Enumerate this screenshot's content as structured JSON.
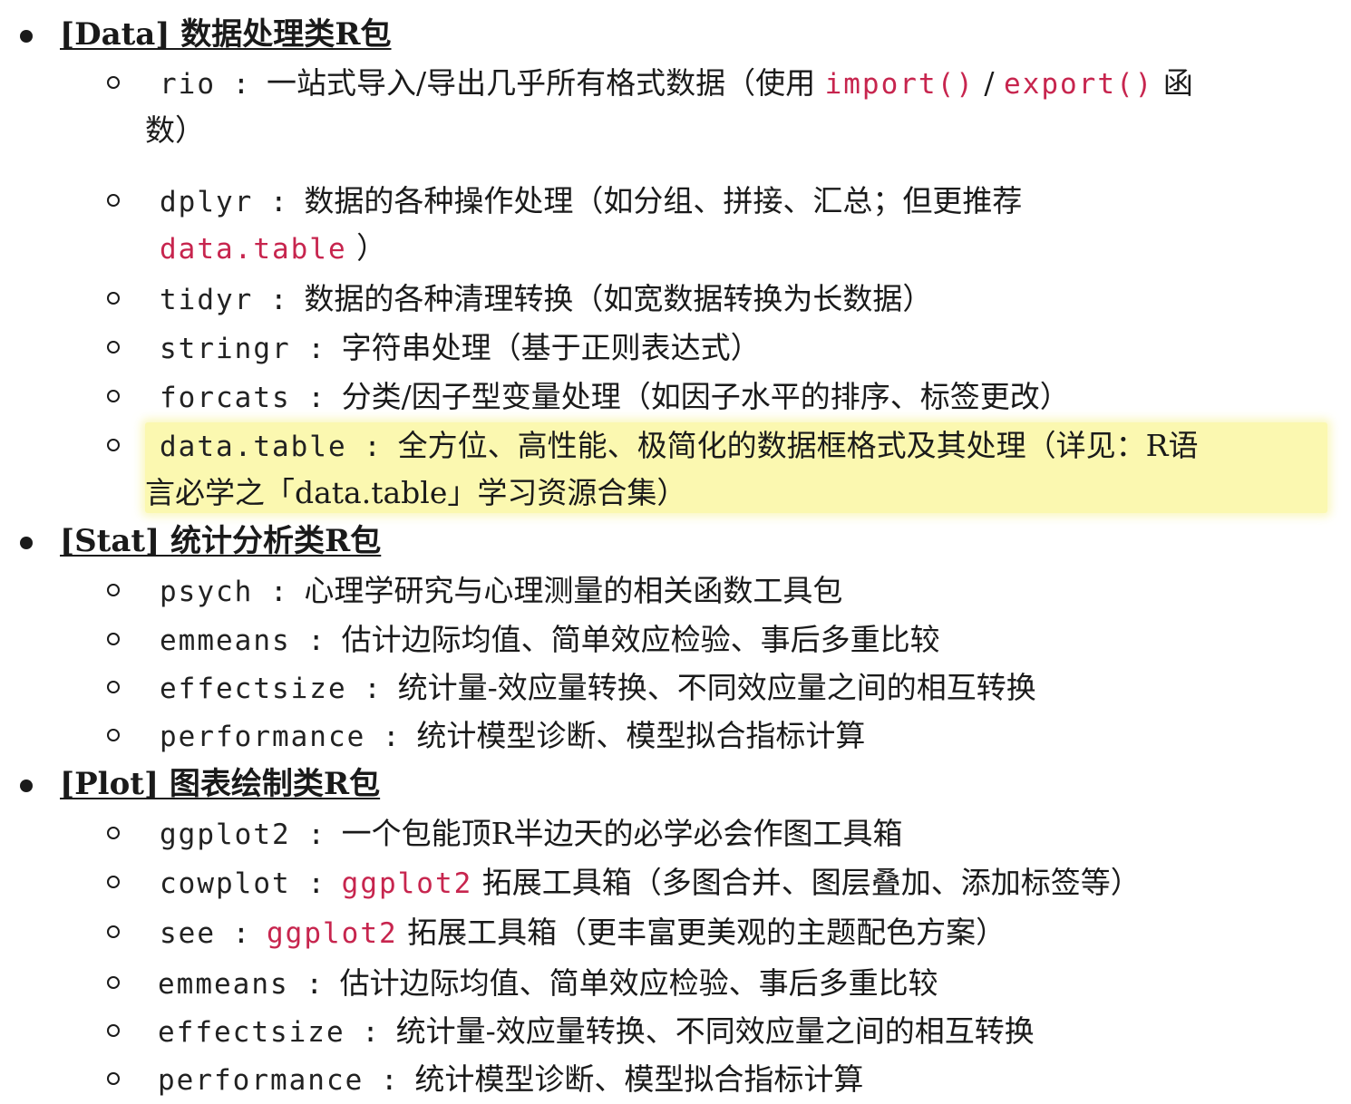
{
  "sections": [
    {
      "title": "[Data] 数据处理类R包",
      "items": [
        {
          "pkg": "rio",
          "sep": " : ",
          "desc_a": "一站式导入/导出几乎所有格式数据（使用 ",
          "code1": "import()",
          "mid": " / ",
          "code2": "export()",
          "desc_b": " 函",
          "desc_c": "数）"
        },
        {
          "pkg": "dplyr",
          "sep": " : ",
          "desc_a": "数据的各种操作处理（如分组、拼接、汇总；但更推荐",
          "code1": "data.table",
          "desc_b": " ）"
        },
        {
          "pkg": "tidyr",
          "sep": " : ",
          "desc": "数据的各种清理转换（如宽数据转换为长数据）"
        },
        {
          "pkg": "stringr",
          "sep": " : ",
          "desc": "字符串处理（基于正则表达式）"
        },
        {
          "pkg": "forcats",
          "sep": " : ",
          "desc": "分类/因子型变量处理（如因子水平的排序、标签更改）"
        },
        {
          "pkg": "data.table",
          "sep": " : ",
          "desc_a": "全方位、高性能、极简化的数据框格式及其处理（详见：R语",
          "desc_b": "言必学之「data.table」学习资源合集）"
        }
      ]
    },
    {
      "title": "[Stat] 统计分析类R包",
      "items": [
        {
          "pkg": "psych",
          "sep": " : ",
          "desc": "心理学研究与心理测量的相关函数工具包"
        },
        {
          "pkg": "emmeans",
          "sep": " : ",
          "desc": "估计边际均值、简单效应检验、事后多重比较"
        },
        {
          "pkg": "effectsize",
          "sep": " : ",
          "desc": "统计量-效应量转换、不同效应量之间的相互转换"
        },
        {
          "pkg": "performance",
          "sep": " : ",
          "desc": "统计模型诊断、模型拟合指标计算"
        }
      ]
    },
    {
      "title": "[Plot] 图表绘制类R包",
      "items": [
        {
          "pkg": "ggplot2",
          "sep": " : ",
          "desc": "一个包能顶R半边天的必学必会作图工具箱"
        },
        {
          "pkg": "cowplot",
          "sep": " :  ",
          "code1": "ggplot2",
          "desc": " 拓展工具箱（多图合并、图层叠加、添加标签等）"
        },
        {
          "pkg": "see",
          "sep": " :  ",
          "code1": "ggplot2",
          "desc": " 拓展工具箱（更丰富更美观的主题配色方案）"
        },
        {
          "pkg": "emmeans",
          "sep": " : ",
          "desc": "估计边际均值、简单效应检验、事后多重比较"
        },
        {
          "pkg": "effectsize",
          "sep": " : ",
          "desc": "统计量-效应量转换、不同效应量之间的相互转换"
        },
        {
          "pkg": "performance",
          "sep": " : ",
          "desc": "统计模型诊断、模型拟合指标计算"
        }
      ]
    }
  ],
  "colors": {
    "code": "#c7254e",
    "highlight": "#fbf8b0",
    "text": "#1a1a1a"
  }
}
